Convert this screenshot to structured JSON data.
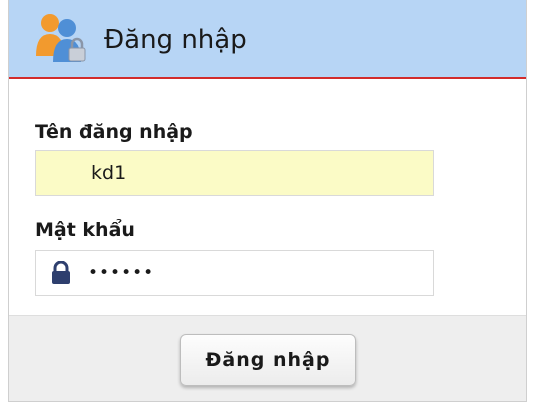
{
  "header": {
    "title": "Đăng nhập",
    "icon": "users-lock-icon",
    "background_color": "#b7d5f5",
    "accent_border_color": "#d22c2c"
  },
  "form": {
    "username": {
      "label": "Tên đăng nhập",
      "value": "kd1",
      "background_color": "#fbfbc6"
    },
    "password": {
      "label": "Mật khẩu",
      "value": "••••••",
      "icon": "lock-icon"
    }
  },
  "footer": {
    "submit_label": "Đăng nhập"
  }
}
